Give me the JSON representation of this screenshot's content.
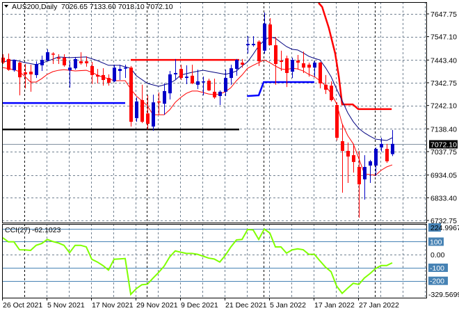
{
  "header": {
    "symbol": "AUS200,Daily",
    "ohlc": "7026.65 7133.60 7018.10 7072.10"
  },
  "colors": {
    "bull": "#0000c8",
    "bear": "#ff0000",
    "ma_slow": "#000080",
    "ma_fast": "#ff0000",
    "cci_line": "#7fff00",
    "cci_levels": "#4682b4",
    "grid": "#708090"
  },
  "chart_data": [
    {
      "type": "candlestick",
      "title": "AUS200,Daily",
      "ylim": [
        6732.75,
        7647.75
      ],
      "current_price": 7072.1,
      "current_price_label": "7072.10",
      "yticks": [
        "7647.75",
        "7547.10",
        "7443.40",
        "7342.75",
        "7242.10",
        "7138.40",
        "7037.75",
        "6934.05",
        "6833.40",
        "6732.75"
      ],
      "xticks": [
        {
          "label": "26 Oct 2021",
          "index": 0
        },
        {
          "label": "5 Nov 2021",
          "index": 8
        },
        {
          "label": "17 Nov 2021",
          "index": 16
        },
        {
          "label": "29 Nov 2021",
          "index": 24
        },
        {
          "label": "9 Dec 2021",
          "index": 32
        },
        {
          "label": "21 Dec 2021",
          "index": 40
        },
        {
          "label": "5 Jan 2022",
          "index": 48
        },
        {
          "label": "17 Jan 2022",
          "index": 56
        },
        {
          "label": "27 Jan 2022",
          "index": 64
        }
      ],
      "period_separators": [
        4,
        26,
        47,
        67
      ],
      "candles": [
        [
          7454,
          7469,
          7426,
          7432
        ],
        [
          7448,
          7472,
          7396,
          7400
        ],
        [
          7398,
          7446,
          7392,
          7444
        ],
        [
          7432,
          7438,
          7287,
          7367
        ],
        [
          7389,
          7426,
          7318,
          7380
        ],
        [
          7392,
          7423,
          7303,
          7380
        ],
        [
          7377,
          7438,
          7364,
          7426
        ],
        [
          7420,
          7463,
          7395,
          7444
        ],
        [
          7441,
          7491,
          7438,
          7478
        ],
        [
          7472,
          7478,
          7426,
          7469
        ],
        [
          7454,
          7469,
          7426,
          7451
        ],
        [
          7454,
          7469,
          7414,
          7420
        ],
        [
          7398,
          7438,
          7321,
          7410
        ],
        [
          7407,
          7457,
          7401,
          7448
        ],
        [
          7438,
          7478,
          7423,
          7429
        ],
        [
          7438,
          7460,
          7414,
          7429
        ],
        [
          7417,
          7435,
          7337,
          7377
        ],
        [
          7377,
          7404,
          7340,
          7370
        ],
        [
          7377,
          7407,
          7330,
          7355
        ],
        [
          7364,
          7380,
          7330,
          7343
        ],
        [
          7349,
          7423,
          7346,
          7410
        ],
        [
          7395,
          7423,
          7355,
          7404
        ],
        [
          7407,
          7423,
          7364,
          7410
        ],
        [
          7410,
          7417,
          7149,
          7170
        ],
        [
          7186,
          7278,
          7170,
          7260
        ],
        [
          7266,
          7334,
          7164,
          7170
        ],
        [
          7207,
          7287,
          7136,
          7161
        ],
        [
          7149,
          7290,
          7130,
          7256
        ],
        [
          7260,
          7300,
          7201,
          7256
        ],
        [
          7250,
          7340,
          7201,
          7306
        ],
        [
          7296,
          7395,
          7269,
          7380
        ],
        [
          7380,
          7448,
          7355,
          7386
        ],
        [
          7404,
          7423,
          7355,
          7364
        ],
        [
          7364,
          7420,
          7337,
          7370
        ],
        [
          7374,
          7423,
          7337,
          7340
        ],
        [
          7334,
          7401,
          7315,
          7349
        ],
        [
          7346,
          7370,
          7287,
          7349
        ],
        [
          7352,
          7361,
          7306,
          7309
        ],
        [
          7303,
          7361,
          7272,
          7278
        ],
        [
          7284,
          7309,
          7244,
          7303
        ],
        [
          7303,
          7401,
          7284,
          7364
        ],
        [
          7364,
          7423,
          7334,
          7407
        ],
        [
          7404,
          7448,
          7374,
          7444
        ],
        [
          7432,
          7448,
          7410,
          7423
        ],
        [
          7509,
          7549,
          7472,
          7515
        ],
        [
          7509,
          7549,
          7503,
          7515
        ],
        [
          7525,
          7531,
          7417,
          7438
        ],
        [
          7485,
          7654,
          7472,
          7605
        ],
        [
          7601,
          7629,
          7509,
          7509
        ],
        [
          7509,
          7546,
          7334,
          7426
        ],
        [
          7441,
          7485,
          7395,
          7435
        ],
        [
          7451,
          7463,
          7324,
          7386
        ],
        [
          7392,
          7454,
          7364,
          7444
        ],
        [
          7441,
          7466,
          7401,
          7432
        ],
        [
          7429,
          7481,
          7386,
          7410
        ],
        [
          7423,
          7432,
          7370,
          7410
        ],
        [
          7410,
          7441,
          7370,
          7432
        ],
        [
          7432,
          7435,
          7318,
          7340
        ],
        [
          7334,
          7377,
          7293,
          7312
        ],
        [
          7330,
          7349,
          7260,
          7266
        ],
        [
          7244,
          7256,
          7087,
          7099
        ],
        [
          7084,
          7161,
          6856,
          7041
        ],
        [
          7041,
          7078,
          6899,
          7016
        ],
        [
          7022,
          7072,
          6945,
          6992
        ],
        [
          6970,
          7041,
          6745,
          6893
        ],
        [
          6915,
          7022,
          6825,
          6970
        ],
        [
          6976,
          7001,
          6899,
          6995
        ],
        [
          6976,
          7056,
          6930,
          7050
        ],
        [
          7056,
          7099,
          7038,
          7072
        ],
        [
          7050,
          7072,
          6988,
          6995
        ],
        [
          7026.65,
          7133.6,
          7018.1,
          7072.1
        ]
      ],
      "ma_slow": [
        [
          0,
          7435
        ],
        [
          2,
          7444
        ],
        [
          4,
          7432
        ],
        [
          6,
          7423
        ],
        [
          8,
          7438
        ],
        [
          10,
          7457
        ],
        [
          12,
          7454
        ],
        [
          15,
          7457
        ],
        [
          17,
          7441
        ],
        [
          19,
          7420
        ],
        [
          21,
          7420
        ],
        [
          23,
          7407
        ],
        [
          24,
          7374
        ],
        [
          26,
          7340
        ],
        [
          28,
          7327
        ],
        [
          30,
          7340
        ],
        [
          31,
          7355
        ],
        [
          32,
          7377
        ],
        [
          34,
          7389
        ],
        [
          36,
          7398
        ],
        [
          38,
          7389
        ],
        [
          40,
          7380
        ],
        [
          41,
          7386
        ],
        [
          42,
          7395
        ],
        [
          43,
          7417
        ],
        [
          44,
          7435
        ],
        [
          45,
          7469
        ],
        [
          46,
          7506
        ],
        [
          47,
          7531
        ],
        [
          48,
          7546
        ],
        [
          49,
          7540
        ],
        [
          50,
          7521
        ],
        [
          51,
          7503
        ],
        [
          52,
          7491
        ],
        [
          53,
          7488
        ],
        [
          54,
          7475
        ],
        [
          55,
          7460
        ],
        [
          56,
          7451
        ],
        [
          57,
          7444
        ],
        [
          58,
          7410
        ],
        [
          59,
          7370
        ],
        [
          60,
          7315
        ],
        [
          61,
          7263
        ],
        [
          62,
          7210
        ],
        [
          63,
          7170
        ],
        [
          64,
          7140
        ],
        [
          65,
          7121
        ],
        [
          66,
          7106
        ],
        [
          67,
          7093
        ],
        [
          68,
          7090
        ],
        [
          69,
          7087
        ],
        [
          70,
          7099
        ]
      ],
      "ma_fast": [
        [
          0,
          7410
        ],
        [
          2,
          7401
        ],
        [
          3,
          7392
        ],
        [
          4,
          7370
        ],
        [
          5,
          7346
        ],
        [
          6,
          7346
        ],
        [
          7,
          7361
        ],
        [
          8,
          7380
        ],
        [
          9,
          7392
        ],
        [
          10,
          7398
        ],
        [
          11,
          7401
        ],
        [
          13,
          7395
        ],
        [
          15,
          7398
        ],
        [
          16,
          7389
        ],
        [
          17,
          7377
        ],
        [
          18,
          7367
        ],
        [
          19,
          7361
        ],
        [
          20,
          7352
        ],
        [
          22,
          7352
        ],
        [
          23,
          7315
        ],
        [
          24,
          7284
        ],
        [
          25,
          7263
        ],
        [
          26,
          7241
        ],
        [
          27,
          7201
        ],
        [
          29,
          7201
        ],
        [
          30,
          7223
        ],
        [
          31,
          7256
        ],
        [
          32,
          7278
        ],
        [
          33,
          7296
        ],
        [
          34,
          7306
        ],
        [
          35,
          7306
        ],
        [
          37,
          7293
        ],
        [
          38,
          7290
        ],
        [
          39,
          7293
        ],
        [
          40,
          7303
        ],
        [
          41,
          7321
        ],
        [
          42,
          7352
        ],
        [
          43,
          7377
        ],
        [
          44,
          7407
        ],
        [
          45,
          7420
        ],
        [
          46,
          7432
        ],
        [
          47,
          7444
        ],
        [
          48,
          7432
        ],
        [
          49,
          7417
        ],
        [
          50,
          7404
        ],
        [
          51,
          7401
        ],
        [
          52,
          7407
        ],
        [
          53,
          7404
        ],
        [
          54,
          7395
        ],
        [
          55,
          7380
        ],
        [
          56,
          7370
        ],
        [
          57,
          7352
        ],
        [
          58,
          7330
        ],
        [
          59,
          7296
        ],
        [
          60,
          7250
        ],
        [
          61,
          7161
        ],
        [
          62,
          7109
        ],
        [
          63,
          7072
        ],
        [
          64,
          7007
        ],
        [
          65,
          6939
        ],
        [
          66,
          6936
        ],
        [
          67,
          6933
        ],
        [
          68,
          6955
        ],
        [
          69,
          6970
        ],
        [
          70,
          6979
        ]
      ],
      "levels": [
        {
          "name": "resistance-red",
          "color": "#ff0000",
          "points": [
            [
              23,
              7444
            ],
            [
              42.5,
              7444
            ]
          ]
        },
        {
          "name": "support-blue",
          "color": "#0000ff",
          "points": [
            [
              -0.1,
              7253
            ],
            [
              22,
              7253
            ]
          ]
        },
        {
          "name": "support-black",
          "color": "#000000",
          "points": [
            [
              -0.1,
              7136
            ],
            [
              42.5,
              7136
            ]
          ]
        },
        {
          "name": "trail-blue",
          "color": "#0000ff",
          "points": [
            [
              43.9,
              7284
            ],
            [
              46,
              7287
            ],
            [
              46.9,
              7346
            ],
            [
              56,
              7346
            ]
          ]
        },
        {
          "name": "trail-red",
          "color": "#ff0000",
          "points": [
            [
              56.75,
              7697
            ],
            [
              57.4,
              7679
            ],
            [
              58.6,
              7586
            ],
            [
              59.75,
              7472
            ],
            [
              60.4,
              7370
            ],
            [
              61,
              7247
            ],
            [
              62.9,
              7247
            ],
            [
              63.9,
              7226
            ],
            [
              69.9,
              7226
            ]
          ]
        }
      ]
    },
    {
      "type": "line",
      "title": "CCI(27)",
      "value_label": "-62.1023",
      "ylim": [
        -329.5699,
        224.9967
      ],
      "max_label": "224.9967",
      "min_label": "-329.5699",
      "levels": [
        200,
        100,
        -100,
        -200
      ],
      "level_labels": [
        {
          "value": 100,
          "label": "100"
        },
        {
          "value": -100,
          "label": "-100"
        },
        {
          "value": -200,
          "label": "-200"
        }
      ],
      "zero_label": "0.00",
      "values": [
        130,
        99,
        99,
        38,
        37,
        33,
        72,
        86,
        117,
        101,
        90,
        72,
        15,
        72,
        72,
        60,
        -35,
        -56,
        -83,
        -118,
        -35,
        -32,
        -29,
        -304,
        -260,
        -230,
        -226,
        -180,
        -136,
        -88,
        -17,
        29,
        19,
        10,
        10,
        3,
        -11,
        -26,
        -33,
        -56,
        -5,
        60,
        113,
        117,
        193,
        190,
        117,
        197,
        166,
        60,
        60,
        12,
        37,
        45,
        38,
        3,
        3,
        -47,
        -95,
        -130,
        -240,
        -296,
        -256,
        -219,
        -228,
        -178,
        -145,
        -106,
        -83,
        -83,
        -62.1023
      ]
    }
  ]
}
